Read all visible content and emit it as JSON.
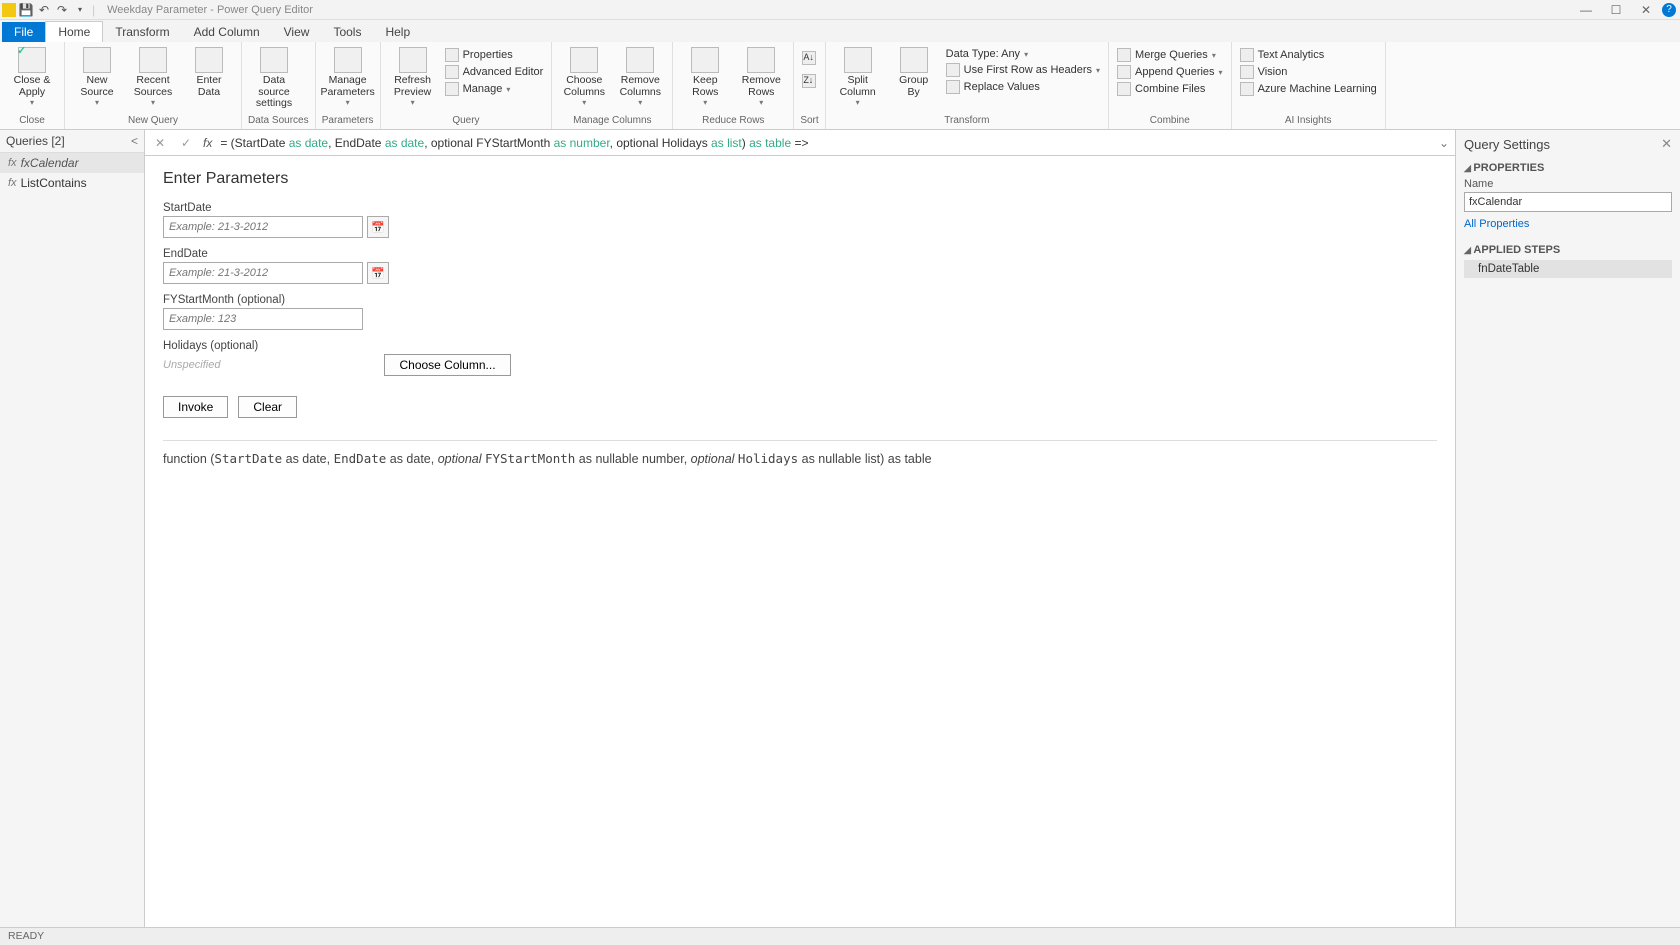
{
  "titlebar": {
    "title": "Weekday Parameter - Power Query Editor"
  },
  "tabs": {
    "file": "File",
    "home": "Home",
    "transform": "Transform",
    "addcolumn": "Add Column",
    "view": "View",
    "tools": "Tools",
    "help": "Help"
  },
  "ribbon": {
    "close": {
      "closeapply": "Close &\nApply"
    },
    "newquery": {
      "newsource": "New\nSource",
      "recentsources": "Recent\nSources",
      "enterdata": "Enter\nData",
      "label": "New Query"
    },
    "datasources": {
      "settings": "Data source\nsettings",
      "label": "Data Sources"
    },
    "parameters": {
      "manage": "Manage\nParameters",
      "label": "Parameters"
    },
    "query": {
      "refresh": "Refresh\nPreview",
      "properties": "Properties",
      "advanced": "Advanced Editor",
      "managebtn": "Manage",
      "label": "Query"
    },
    "managecols": {
      "choose": "Choose\nColumns",
      "remove": "Remove\nColumns",
      "label": "Manage Columns"
    },
    "reducerows": {
      "keep": "Keep\nRows",
      "removerows": "Remove\nRows",
      "label": "Reduce Rows"
    },
    "sort": {
      "label": "Sort"
    },
    "transform": {
      "split": "Split\nColumn",
      "group": "Group\nBy",
      "datatype": "Data Type: Any",
      "headers": "Use First Row as Headers",
      "replace": "Replace Values",
      "label": "Transform"
    },
    "combine": {
      "merge": "Merge Queries",
      "append": "Append Queries",
      "files": "Combine Files",
      "label": "Combine"
    },
    "ai": {
      "text": "Text Analytics",
      "vision": "Vision",
      "ml": "Azure Machine Learning",
      "label": "AI Insights"
    },
    "closelabel": "Close"
  },
  "queries": {
    "header": "Queries [2]",
    "items": [
      {
        "name": "fxCalendar",
        "selected": true
      },
      {
        "name": "ListContains",
        "selected": false
      }
    ]
  },
  "formula": {
    "prefix": "= (StartDate ",
    "as1": "as",
    "t1": " date",
    "c1": ", EndDate ",
    "as2": "as",
    "t2": " date",
    "c2": ", optional FYStartMonth ",
    "as3": "as",
    "t3": " number",
    "c3": ", optional Holidays ",
    "as4": "as",
    "t4": " list",
    "c4": ") ",
    "as5": "as",
    "t5": " table",
    "suffix": " =>"
  },
  "params": {
    "title": "Enter Parameters",
    "startdate": {
      "label": "StartDate",
      "placeholder": "Example: 21-3-2012"
    },
    "enddate": {
      "label": "EndDate",
      "placeholder": "Example: 21-3-2012"
    },
    "fystart": {
      "label": "FYStartMonth (optional)",
      "placeholder": "Example: 123"
    },
    "holidays": {
      "label": "Holidays (optional)",
      "unspecified": "Unspecified",
      "choose": "Choose Column..."
    },
    "invoke": "Invoke",
    "clear": "Clear"
  },
  "signature": {
    "pre": "function (",
    "p1": "StartDate",
    "p1t": " as date, ",
    "p2": "EndDate",
    "p2t": " as date, ",
    "opt1": "optional ",
    "p3": "FYStartMonth",
    "p3t": " as nullable number, ",
    "opt2": "optional ",
    "p4": "Holidays",
    "p4t": " as nullable list) as table"
  },
  "settings": {
    "title": "Query Settings",
    "properties": "PROPERTIES",
    "namelabel": "Name",
    "namevalue": "fxCalendar",
    "allprops": "All Properties",
    "applied": "APPLIED STEPS",
    "step1": "fnDateTable"
  },
  "status": "READY"
}
